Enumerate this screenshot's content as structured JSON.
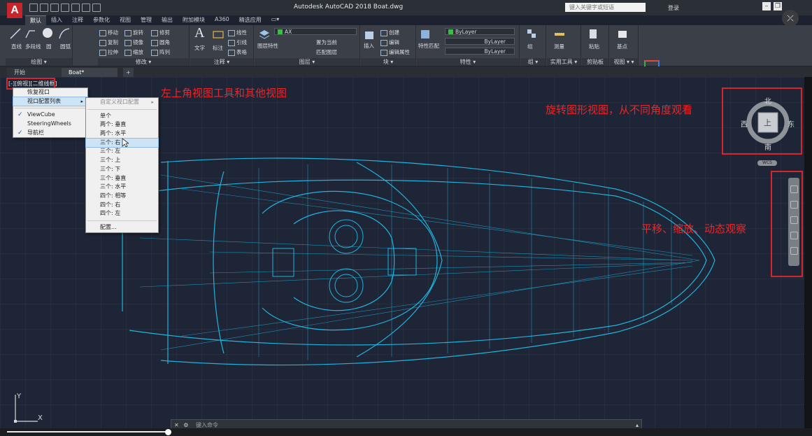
{
  "app": {
    "logo_letter": "A",
    "title": "Autodesk AutoCAD 2018     Boat.dwg",
    "search_placeholder": "键入关键字或短语",
    "login_label": "登录",
    "close_glyph": "⤫"
  },
  "ribbon_tabs": [
    {
      "label": "默认",
      "active": true
    },
    {
      "label": "插入"
    },
    {
      "label": "注释"
    },
    {
      "label": "参数化"
    },
    {
      "label": "视图"
    },
    {
      "label": "管理"
    },
    {
      "label": "输出"
    },
    {
      "label": "附加模块"
    },
    {
      "label": "A360"
    },
    {
      "label": "精选应用"
    },
    {
      "label": "▭▾"
    }
  ],
  "ribbon": {
    "draw": {
      "footer": "绘图 ▾",
      "tools": [
        "直线",
        "多段线",
        "圆",
        "圆弧"
      ]
    },
    "modify": {
      "footer": "修改 ▾",
      "tools": [
        "移动",
        "旋转",
        "修剪",
        "复制",
        "镜像",
        "圆角",
        "拉伸",
        "缩放",
        "阵列"
      ]
    },
    "annotation": {
      "footer": "注释 ▾",
      "tools": [
        "文字",
        "标注",
        "线性",
        "引线",
        "表格"
      ]
    },
    "layers": {
      "footer": "图层 ▾",
      "tools": [
        "图层特性",
        "置为当前",
        "匹配图层"
      ],
      "layer_name": "AX"
    },
    "block": {
      "footer": "块 ▾",
      "tools": [
        "插入",
        "创建",
        "编辑",
        "编辑属性"
      ]
    },
    "properties": {
      "footer": "特性 ▾",
      "tools": [
        "特性匹配"
      ],
      "dropdowns": [
        "ByLayer",
        "ByLayer",
        "ByLayer"
      ]
    },
    "groups": {
      "footer": "组 ▾",
      "tools": [
        "组"
      ]
    },
    "utilities": {
      "footer": "实用工具 ▾",
      "tools": [
        "测量"
      ]
    },
    "clipboard": {
      "footer": "剪贴板",
      "tools": [
        "粘贴"
      ]
    },
    "view": {
      "footer": "视图 ▾ ▾",
      "tools": [
        "基点"
      ]
    }
  },
  "doc_tabs": [
    {
      "label": "开始"
    },
    {
      "label": "Boat*"
    },
    {
      "label": "+"
    }
  ],
  "viewport": {
    "label": "[-][俯视][二维线框]"
  },
  "context_menu": {
    "items": [
      {
        "label": "恢复视口",
        "check": ""
      },
      {
        "label": "视口配置列表",
        "check": "",
        "has_submenu": true
      },
      {
        "label": "ViewCube",
        "check": "✓"
      },
      {
        "label": "SteeringWheels",
        "check": ""
      },
      {
        "label": "导航栏",
        "check": "✓"
      }
    ]
  },
  "submenu": {
    "items": [
      {
        "label": "自定义视口配置",
        "disabled": true,
        "arrow": "▸"
      },
      {
        "label": "单个"
      },
      {
        "label": "两个: 垂直"
      },
      {
        "label": "两个: 水平"
      },
      {
        "label": "三个: 右",
        "highlight": true
      },
      {
        "label": "三个: 左"
      },
      {
        "label": "三个: 上"
      },
      {
        "label": "三个: 下"
      },
      {
        "label": "三个: 垂直"
      },
      {
        "label": "三个: 水平"
      },
      {
        "label": "四个: 相等"
      },
      {
        "label": "四个: 右"
      },
      {
        "label": "四个: 左"
      },
      {
        "label": "配置..."
      }
    ]
  },
  "annotations": {
    "top_left": "左上角视图工具和其他视图",
    "viewcube": "旋转图形视图，从不同角度观看",
    "navbar": "平移、缩放、动态观察"
  },
  "viewcube": {
    "north": "北",
    "south": "南",
    "east": "东",
    "west": "西",
    "top": "上",
    "wcs": "WCS"
  },
  "ucs": {
    "x": "X",
    "y": "Y"
  },
  "command_line": {
    "placeholder": "键入命令"
  },
  "colors": {
    "accent_red": "#d8242b",
    "wireframe": "#1fb4df"
  }
}
